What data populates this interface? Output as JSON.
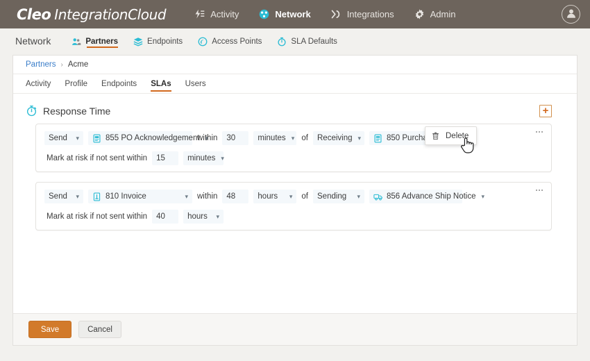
{
  "header": {
    "brand_primary": "Cleo",
    "brand_secondary": "IntegrationCloud",
    "nav": [
      {
        "label": "Activity",
        "icon": "activity-icon",
        "active": false
      },
      {
        "label": "Network",
        "icon": "network-icon",
        "active": true
      },
      {
        "label": "Integrations",
        "icon": "integrations-icon",
        "active": false
      },
      {
        "label": "Admin",
        "icon": "gear-icon",
        "active": false
      }
    ],
    "avatar_icon": "user-avatar-icon",
    "bar_color": "#6d645c"
  },
  "subnav": {
    "title": "Network",
    "items": [
      {
        "label": "Partners",
        "icon": "partners-icon",
        "active": true
      },
      {
        "label": "Endpoints",
        "icon": "endpoints-icon",
        "active": false
      },
      {
        "label": "Access Points",
        "icon": "access-points-icon",
        "active": false
      },
      {
        "label": "SLA Defaults",
        "icon": "sla-defaults-icon",
        "active": false
      }
    ],
    "accent_color": "#d2691e"
  },
  "breadcrumb": {
    "root": "Partners",
    "separator": "›",
    "current": "Acme"
  },
  "tabs": [
    {
      "label": "Activity",
      "active": false
    },
    {
      "label": "Profile",
      "active": false
    },
    {
      "label": "Endpoints",
      "active": false
    },
    {
      "label": "SLAs",
      "active": true
    },
    {
      "label": "Users",
      "active": false
    }
  ],
  "section": {
    "title": "Response Time",
    "icon": "stopwatch-icon",
    "add_button_label": "+",
    "add_button_color": "#d2691e"
  },
  "sla_rows": [
    {
      "direction": "Send",
      "document": "855 PO Acknowledgement",
      "document_icon": "document-icon",
      "within_label": "within",
      "amount": "30",
      "unit": "minutes",
      "of_label": "of",
      "counter_direction": "Receiving",
      "counter_document": "850 Purchase Order",
      "counter_document_icon": "document-icon",
      "risk_label": "Mark at risk if not sent within",
      "risk_amount": "15",
      "risk_unit": "minutes",
      "menu_icon": "kebab-menu-icon"
    },
    {
      "direction": "Send",
      "document": "810 Invoice",
      "document_icon": "invoice-icon",
      "within_label": "within",
      "amount": "48",
      "unit": "hours",
      "of_label": "of",
      "counter_direction": "Sending",
      "counter_document": "856 Advance Ship Notice",
      "counter_document_icon": "truck-icon",
      "risk_label": "Mark at risk if not sent within",
      "risk_amount": "40",
      "risk_unit": "hours",
      "menu_icon": "kebab-menu-icon"
    }
  ],
  "context_menu": {
    "visible": true,
    "items": [
      {
        "label": "Delete",
        "icon": "trash-icon"
      }
    ]
  },
  "footer": {
    "save_label": "Save",
    "cancel_label": "Cancel",
    "save_color": "#d27a2a"
  }
}
